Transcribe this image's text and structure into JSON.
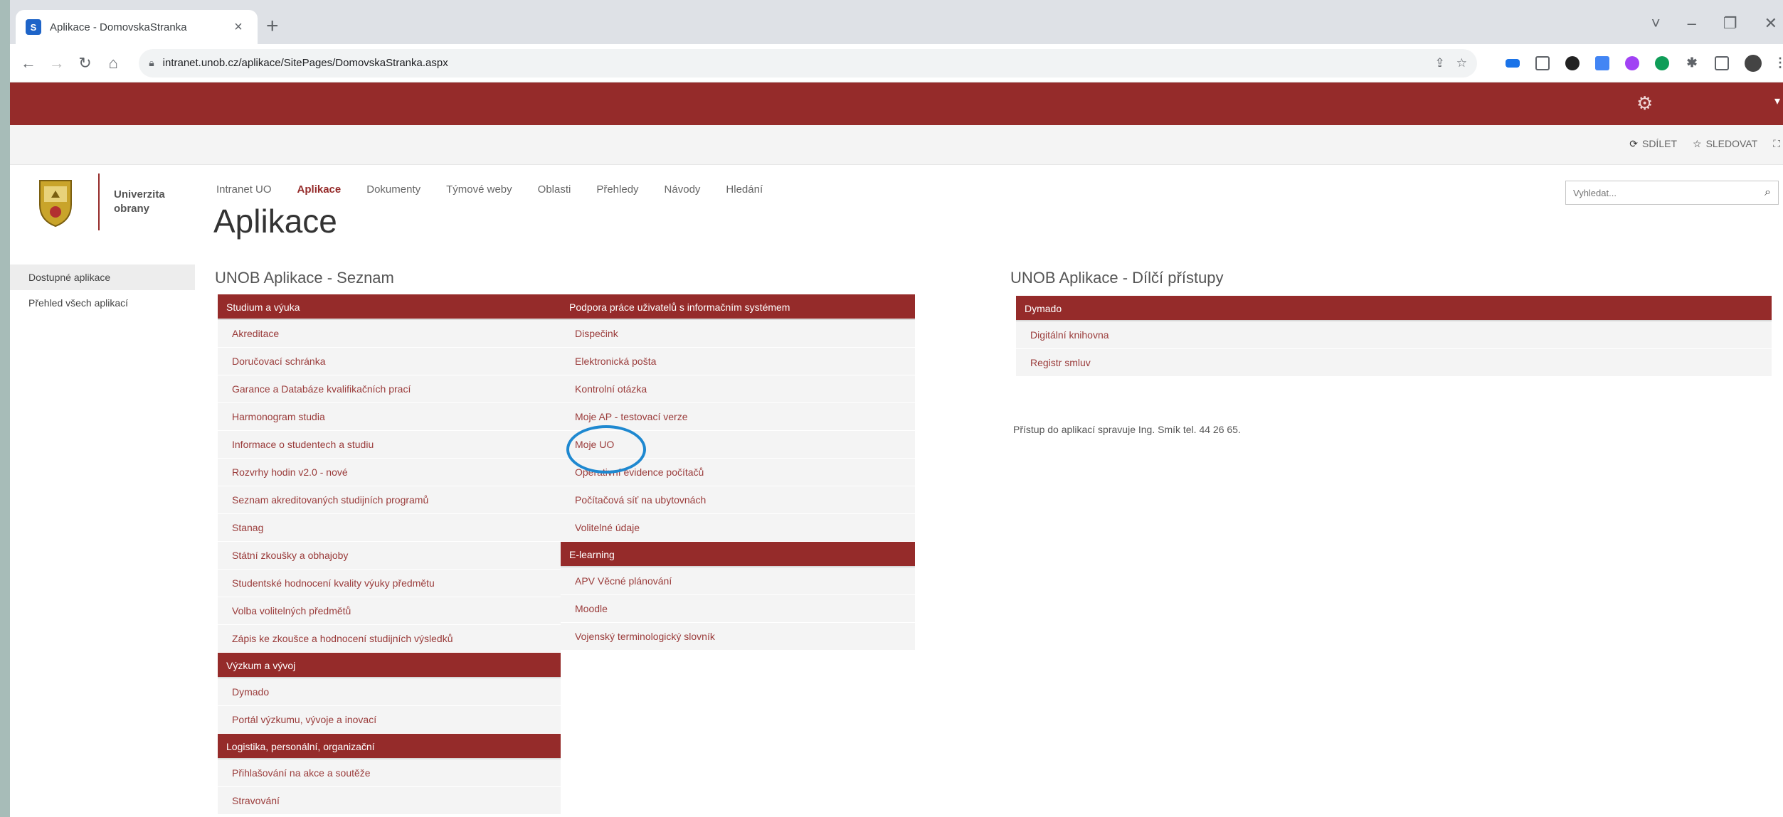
{
  "browser": {
    "tab_title": "Aplikace - DomovskaStranka",
    "tab_favicon": "S",
    "tab_close": "×",
    "new_tab": "+",
    "url": "intranet.unob.cz/aplikace/SitePages/DomovskaStranka.aspx",
    "window_controls": [
      "˅",
      "–",
      "❐",
      "✕"
    ]
  },
  "ribbon": {
    "share": "SDÍLET",
    "follow": "SLEDOVAT"
  },
  "logo": {
    "line1": "Univerzita",
    "line2": "obrany"
  },
  "topnav": [
    "Intranet UO",
    "Aplikace",
    "Dokumenty",
    "Týmové weby",
    "Oblasti",
    "Přehledy",
    "Návody",
    "Hledání"
  ],
  "topnav_active": "Aplikace",
  "page_title": "Aplikace",
  "search": {
    "placeholder": "Vyhledat..."
  },
  "leftnav": [
    "Dostupné aplikace",
    "Přehled všech aplikací"
  ],
  "seznam": {
    "heading": "UNOB Aplikace - Seznam",
    "col1": [
      {
        "header": "Studium a výuka",
        "items": [
          "Akreditace",
          "Doručovací schránka",
          "Garance a Databáze kvalifikačních prací",
          "Harmonogram studia",
          "Informace o studentech a studiu",
          "Rozvrhy hodin v2.0 - nové",
          "Seznam akreditovaných studijních programů",
          "Stanag",
          "Státní zkoušky a obhajoby",
          "Studentské hodnocení kvality výuky předmětu",
          "Volba volitelných předmětů",
          "Zápis ke zkoušce a hodnocení studijních výsledků"
        ]
      },
      {
        "header": "Výzkum a vývoj",
        "items": [
          "Dymado",
          "Portál výzkumu, vývoje a inovací"
        ]
      },
      {
        "header": "Logistika, personální, organizační",
        "items": [
          "Přihlašování na akce a soutěže",
          "Stravování"
        ]
      }
    ],
    "col2": [
      {
        "header": "Podpora práce uživatelů s informačním systémem",
        "items": [
          "Dispečink",
          "Elektronická pošta",
          "Kontrolní otázka",
          "Moje AP - testovací verze",
          "Moje UO",
          "Operativní evidence počítačů",
          "Počítačová síť na ubytovnách",
          "Volitelné údaje"
        ]
      },
      {
        "header": "E-learning",
        "items": [
          "APV Věcné plánování",
          "Moodle",
          "Vojenský terminologický slovník"
        ]
      }
    ]
  },
  "dilci": {
    "heading": "UNOB Aplikace - Dílčí přístupy",
    "header": "Dymado",
    "items": [
      "Digitální knihovna",
      "Registr smluv"
    ],
    "note": "Přístup do aplikací spravuje Ing. Smík tel. 44 26 65."
  },
  "colors": {
    "brand": "#952b2a",
    "annotation": "#1e88d0"
  }
}
